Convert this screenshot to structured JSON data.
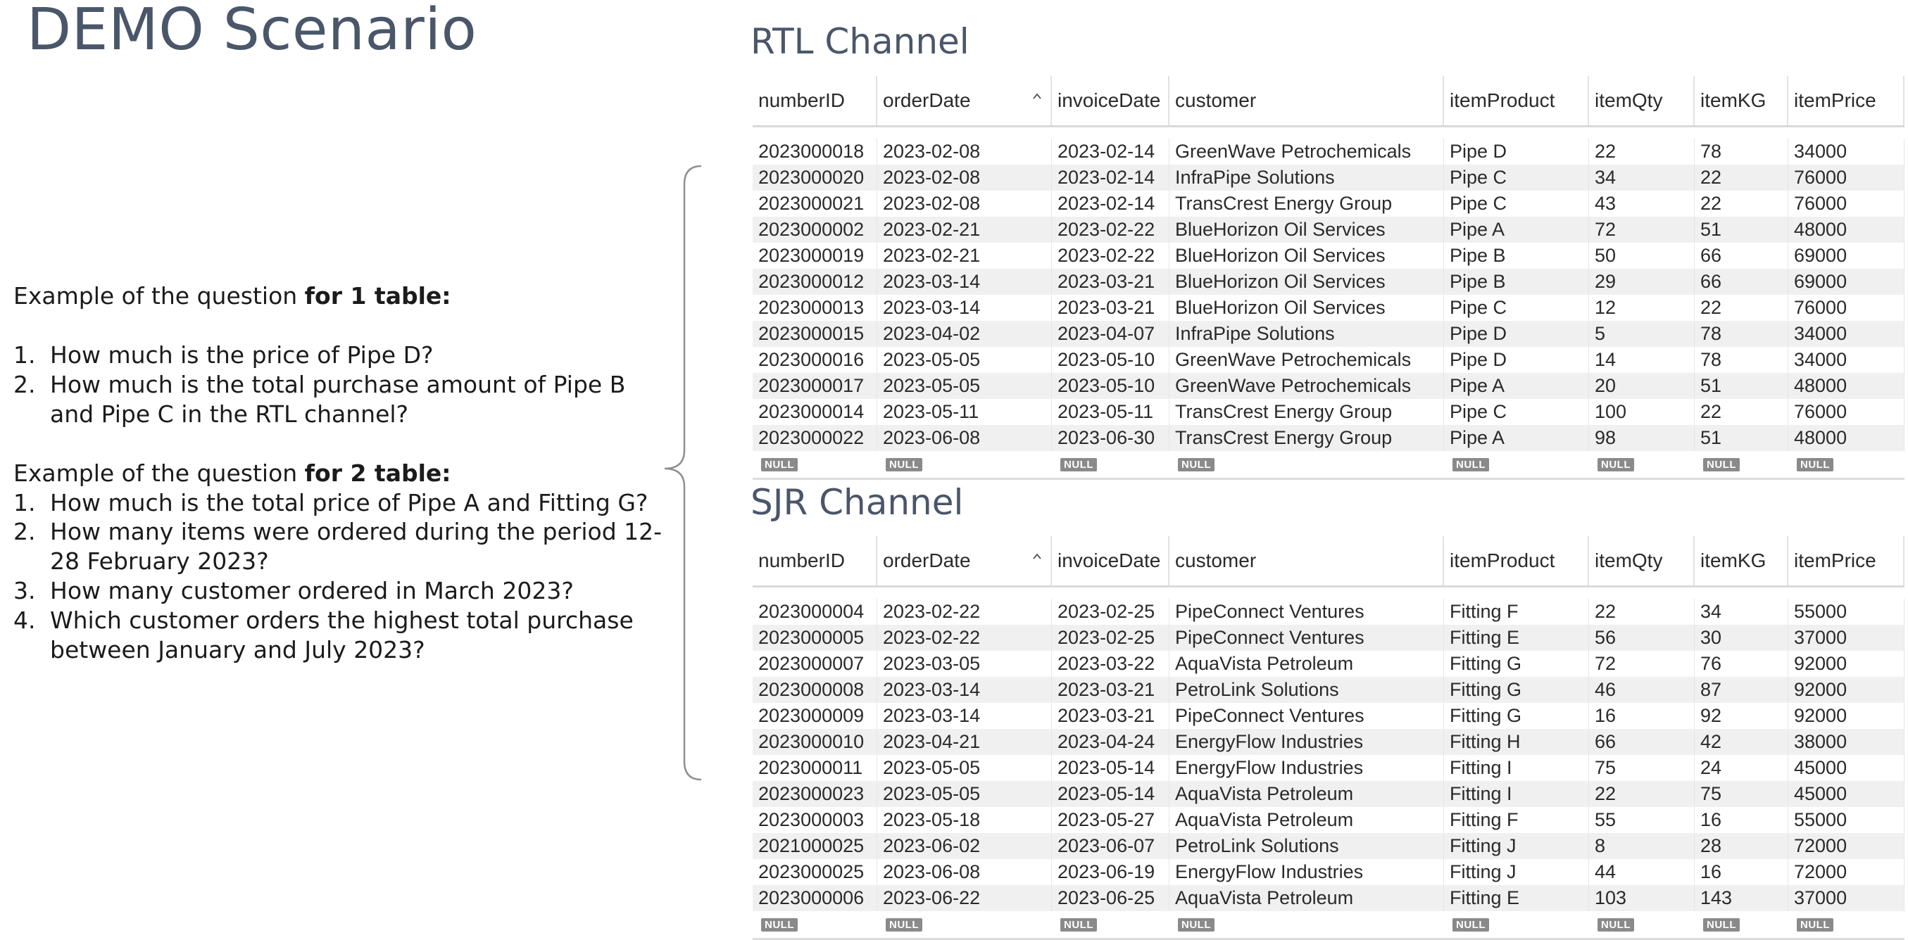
{
  "page_title": "DEMO Scenario",
  "questions": {
    "one_table_intro_prefix": "Example of the question ",
    "one_table_intro_bold": "for 1 table:",
    "one_table": [
      {
        "num": "1.",
        "text": "How much is the price of Pipe D?"
      },
      {
        "num": "2.",
        "text": "How much is the total purchase amount of Pipe B and Pipe C in the RTL channel?"
      }
    ],
    "two_table_intro_prefix": "Example of the question ",
    "two_table_intro_bold": "for 2 table:",
    "two_table": [
      {
        "num": "1.",
        "text": "How much is the total price of Pipe A and Fitting G?"
      },
      {
        "num": "2.",
        "text": "How many items were ordered during the period 12-28 February 2023?"
      },
      {
        "num": "3.",
        "text": "How many customer ordered in March 2023?"
      },
      {
        "num": "4.",
        "text": "Which customer orders the highest total purchase between January and July 2023?"
      }
    ]
  },
  "rtl": {
    "title": "RTL Channel",
    "columns": [
      "numberID",
      "orderDate",
      "invoiceDate",
      "customer",
      "itemProduct",
      "itemQty",
      "itemKG",
      "itemPrice"
    ],
    "rows": [
      [
        "2023000018",
        "2023-02-08",
        "2023-02-14",
        "GreenWave Petrochemicals",
        "Pipe D",
        "22",
        "78",
        "34000"
      ],
      [
        "2023000020",
        "2023-02-08",
        "2023-02-14",
        "InfraPipe Solutions",
        "Pipe C",
        "34",
        "22",
        "76000"
      ],
      [
        "2023000021",
        "2023-02-08",
        "2023-02-14",
        "TransCrest Energy Group",
        "Pipe C",
        "43",
        "22",
        "76000"
      ],
      [
        "2023000002",
        "2023-02-21",
        "2023-02-22",
        "BlueHorizon Oil Services",
        "Pipe A",
        "72",
        "51",
        "48000"
      ],
      [
        "2023000019",
        "2023-02-21",
        "2023-02-22",
        "BlueHorizon Oil Services",
        "Pipe B",
        "50",
        "66",
        "69000"
      ],
      [
        "2023000012",
        "2023-03-14",
        "2023-03-21",
        "BlueHorizon Oil Services",
        "Pipe B",
        "29",
        "66",
        "69000"
      ],
      [
        "2023000013",
        "2023-03-14",
        "2023-03-21",
        "BlueHorizon Oil Services",
        "Pipe C",
        "12",
        "22",
        "76000"
      ],
      [
        "2023000015",
        "2023-04-02",
        "2023-04-07",
        "InfraPipe Solutions",
        "Pipe D",
        "5",
        "78",
        "34000"
      ],
      [
        "2023000016",
        "2023-05-05",
        "2023-05-10",
        "GreenWave Petrochemicals",
        "Pipe D",
        "14",
        "78",
        "34000"
      ],
      [
        "2023000017",
        "2023-05-05",
        "2023-05-10",
        "GreenWave Petrochemicals",
        "Pipe A",
        "20",
        "51",
        "48000"
      ],
      [
        "2023000014",
        "2023-05-11",
        "2023-05-11",
        "TransCrest Energy Group",
        "Pipe C",
        "100",
        "22",
        "76000"
      ],
      [
        "2023000022",
        "2023-06-08",
        "2023-06-30",
        "TransCrest Energy Group",
        "Pipe A",
        "98",
        "51",
        "48000"
      ]
    ],
    "null_label": "NULL"
  },
  "sjr": {
    "title": "SJR Channel",
    "columns": [
      "numberID",
      "orderDate",
      "invoiceDate",
      "customer",
      "itemProduct",
      "itemQty",
      "itemKG",
      "itemPrice"
    ],
    "rows": [
      [
        "2023000004",
        "2023-02-22",
        "2023-02-25",
        "PipeConnect Ventures",
        "Fitting F",
        "22",
        "34",
        "55000"
      ],
      [
        "2023000005",
        "2023-02-22",
        "2023-02-25",
        "PipeConnect Ventures",
        "Fitting E",
        "56",
        "30",
        "37000"
      ],
      [
        "2023000007",
        "2023-03-05",
        "2023-03-22",
        "AquaVista Petroleum",
        "Fitting G",
        "72",
        "76",
        "92000"
      ],
      [
        "2023000008",
        "2023-03-14",
        "2023-03-21",
        "PetroLink Solutions",
        "Fitting G",
        "46",
        "87",
        "92000"
      ],
      [
        "2023000009",
        "2023-03-14",
        "2023-03-21",
        "PipeConnect Ventures",
        "Fitting G",
        "16",
        "92",
        "92000"
      ],
      [
        "2023000010",
        "2023-04-21",
        "2023-04-24",
        "EnergyFlow Industries",
        "Fitting H",
        "66",
        "42",
        "38000"
      ],
      [
        "2023000011",
        "2023-05-05",
        "2023-05-14",
        "EnergyFlow Industries",
        "Fitting I",
        "75",
        "24",
        "45000"
      ],
      [
        "2023000023",
        "2023-05-05",
        "2023-05-14",
        "AquaVista Petroleum",
        "Fitting I",
        "22",
        "75",
        "45000"
      ],
      [
        "2023000003",
        "2023-05-18",
        "2023-05-27",
        "AquaVista Petroleum",
        "Fitting F",
        "55",
        "16",
        "55000"
      ],
      [
        "2021000025",
        "2023-06-02",
        "2023-06-07",
        "PetroLink Solutions",
        "Fitting J",
        "8",
        "28",
        "72000"
      ],
      [
        "2023000025",
        "2023-06-08",
        "2023-06-19",
        "EnergyFlow Industries",
        "Fitting J",
        "44",
        "16",
        "72000"
      ],
      [
        "2023000006",
        "2023-06-22",
        "2023-06-25",
        "AquaVista Petroleum",
        "Fitting E",
        "103",
        "143",
        "37000"
      ]
    ],
    "null_label": "NULL"
  },
  "icons": {
    "sort": "chevron-up-icon",
    "bracket": "curly-bracket"
  },
  "colors": {
    "title": "#4a5669",
    "zebra": "#f0f0f0",
    "null_badge": "#8a8a8a"
  }
}
